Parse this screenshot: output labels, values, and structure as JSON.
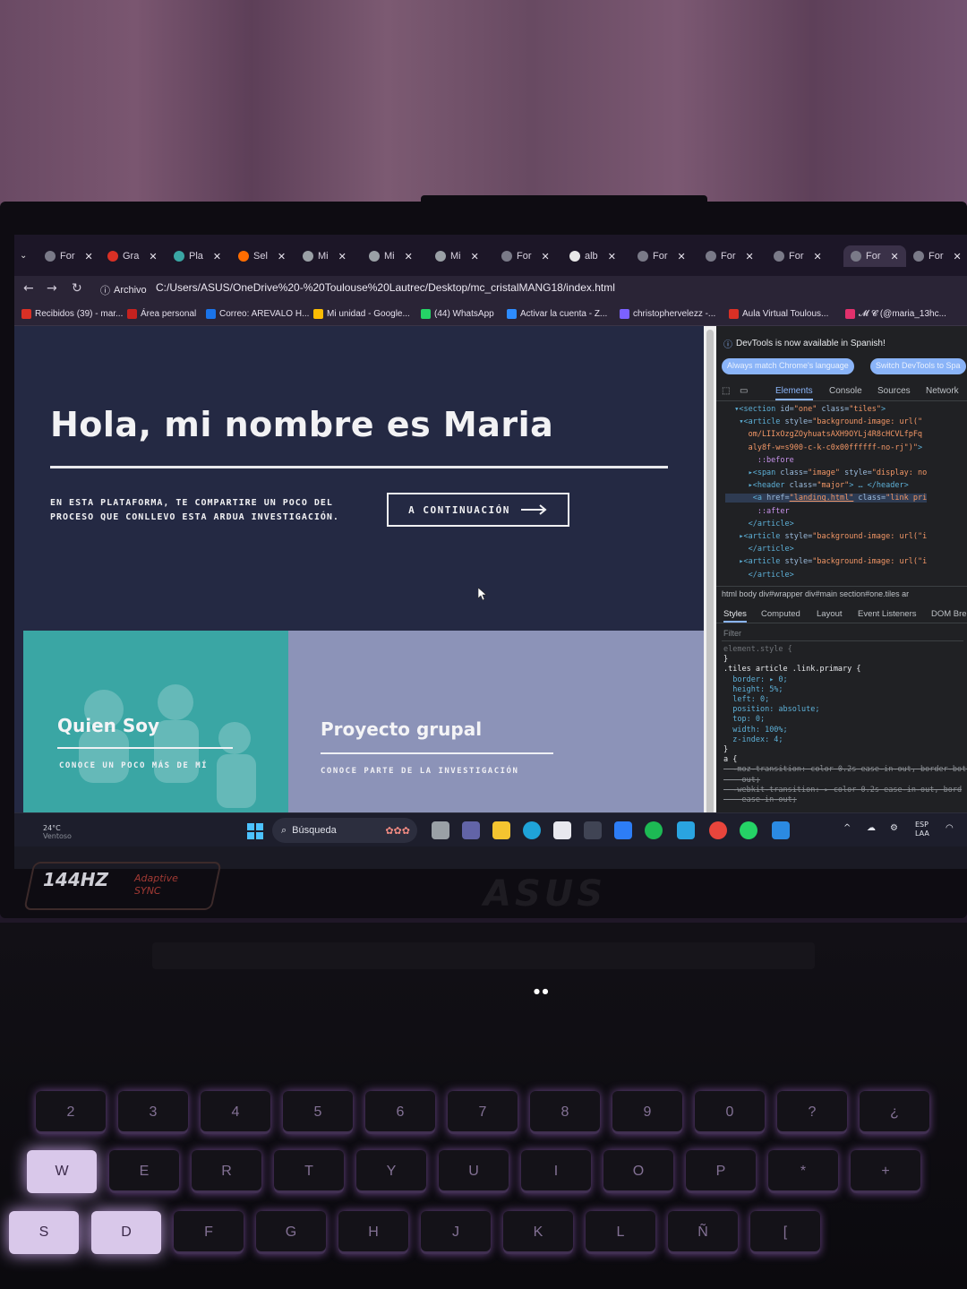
{
  "browser": {
    "tabs": [
      {
        "label": "For",
        "color": "#7a7a88"
      },
      {
        "label": "Gra",
        "color": "#d93025"
      },
      {
        "label": "Pla",
        "color": "#3aa6a4"
      },
      {
        "label": "Sel",
        "color": "#ff6d00"
      },
      {
        "label": "Mi",
        "color": "#9aa0a6"
      },
      {
        "label": "Mi",
        "color": "#9aa0a6"
      },
      {
        "label": "Mi",
        "color": "#9aa0a6"
      },
      {
        "label": "For",
        "color": "#7a7a88"
      },
      {
        "label": "alb",
        "color": "#e8e8e8"
      },
      {
        "label": "For",
        "color": "#7a7a88"
      },
      {
        "label": "For",
        "color": "#7a7a88"
      },
      {
        "label": "For",
        "color": "#7a7a88"
      },
      {
        "label": "For",
        "color": "#7a7a88"
      },
      {
        "label": "For",
        "color": "#7a7a88"
      }
    ],
    "active_tab_index": 12,
    "address": {
      "prefix": "Archivo",
      "url": "C:/Users/ASUS/OneDrive%20-%20Toulouse%20Lautrec/Desktop/mc_cristalMANG18/index.html"
    },
    "bookmarks": [
      {
        "label": "Recibidos (39) - mar...",
        "color": "#d93025"
      },
      {
        "label": "Área personal",
        "color": "#c5221f"
      },
      {
        "label": "Correo: AREVALO H...",
        "color": "#1a73e8"
      },
      {
        "label": "Mi unidad - Google...",
        "color": "#fbbc04"
      },
      {
        "label": "(44) WhatsApp",
        "color": "#25d366"
      },
      {
        "label": "Activar la cuenta - Z...",
        "color": "#2d8cff"
      },
      {
        "label": "christophervelezz -...",
        "color": "#7b61ff"
      },
      {
        "label": "Aula Virtual Toulous...",
        "color": "#d93025"
      },
      {
        "label": "𝓜 𝓒 (@maria_13hc...",
        "color": "#e1306c"
      }
    ]
  },
  "page": {
    "title": "Hola, mi nombre es Maria",
    "intro": "En esta plataforma, te compartire un poco del proceso que conllevo esta ardua investigación.",
    "cta_label": "A continuación",
    "tiles": [
      {
        "title": "Quien Soy",
        "subtitle": "Conoce un poco más de mí",
        "color": "#3aa6a4"
      },
      {
        "title": "Proyecto grupal",
        "subtitle": "Conoce parte de la investigación",
        "color": "#8c93b8"
      }
    ]
  },
  "devtools": {
    "notice": "DevTools is now available in Spanish!",
    "buttons": [
      "Always match Chrome's language",
      "Switch DevTools to Spa"
    ],
    "tabs": [
      "Elements",
      "Console",
      "Sources",
      "Network"
    ],
    "breadcrumbs": "html   body   div#wrapper   div#main   section#one.tiles   ar",
    "subtabs": [
      "Styles",
      "Computed",
      "Layout",
      "Event Listeners",
      "DOM Break"
    ],
    "filter_placeholder": "Filter",
    "element_style": "element.style {",
    "rule_selector": ".tiles article .link.primary {",
    "rule_props": [
      "border: ▸ 0;",
      "height: 5%;",
      "left: 0;",
      "position: absolute;",
      "top: 0;",
      "width: 100%;",
      "z-index: 4;"
    ]
  },
  "taskbar": {
    "weather_temp": "24°C",
    "weather_desc": "Ventoso",
    "search_placeholder": "Búsqueda",
    "lang_top": "ESP",
    "lang_bottom": "LAA"
  },
  "laptop": {
    "badge_refresh": "144HZ",
    "badge_adaptive": "Adaptive",
    "badge_sync": "SYNC",
    "brand": "ASUS"
  },
  "keyboard": {
    "rows": [
      [
        "2",
        "3",
        "4",
        "5",
        "6",
        "7",
        "8",
        "9",
        "0",
        "?",
        "¿"
      ],
      [
        "W",
        "E",
        "R",
        "T",
        "Y",
        "U",
        "I",
        "O",
        "P",
        "*",
        "+"
      ],
      [
        "S",
        "D",
        "F",
        "G",
        "H",
        "J",
        "K",
        "L",
        "Ñ",
        "["
      ]
    ]
  }
}
